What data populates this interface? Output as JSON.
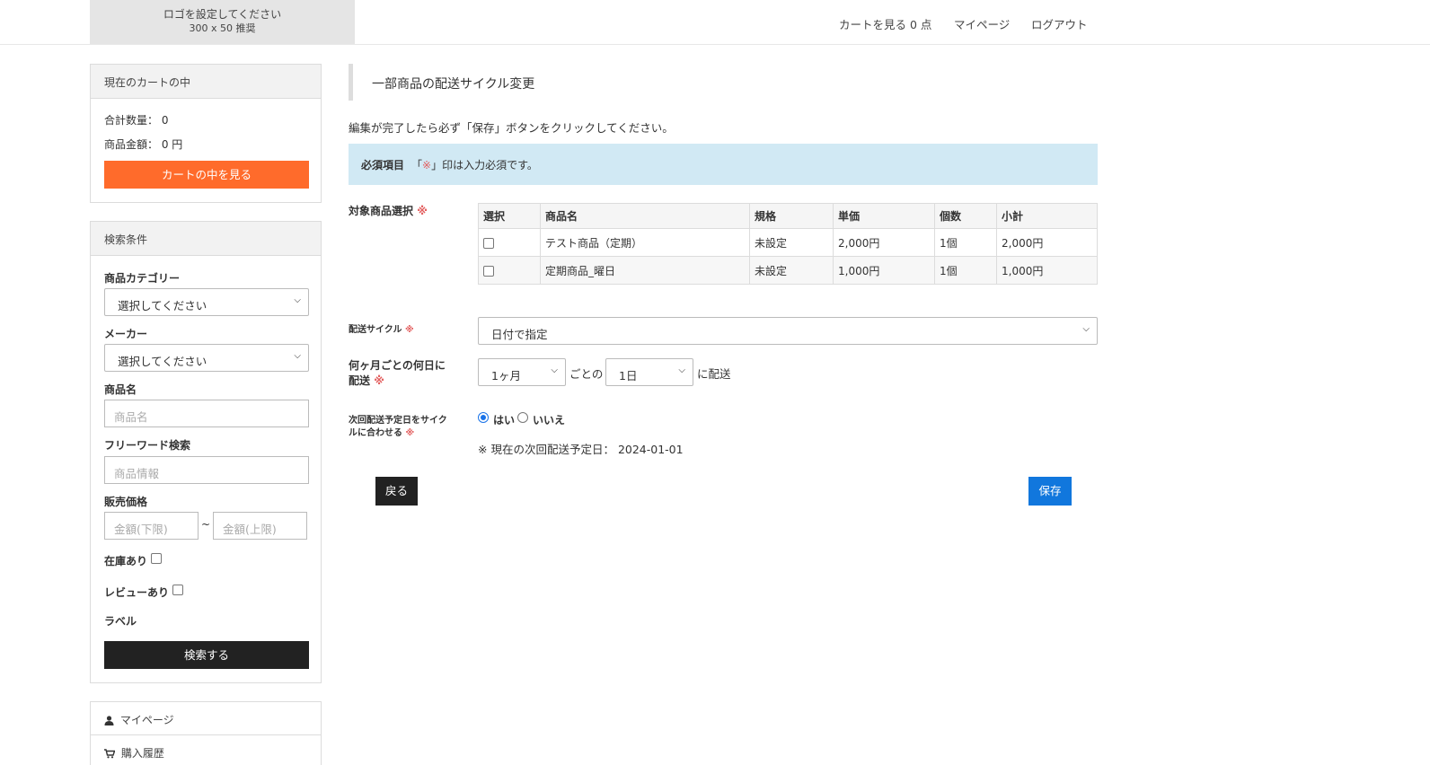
{
  "header": {
    "logo_line1": "ロゴを設定してください",
    "logo_line2": "300 x 50 推奨",
    "nav": {
      "cart": "カートを見る 0 点",
      "mypage": "マイページ",
      "logout": "ログアウト"
    }
  },
  "sidebar": {
    "cart": {
      "title": "現在のカートの中",
      "qty_label": "合計数量：",
      "qty_value": "0",
      "amount_label": "商品金額：",
      "amount_value": "0 円",
      "view_button": "カートの中を見る"
    },
    "search": {
      "title": "検索条件",
      "category_label": "商品カテゴリー",
      "category_value": "選択してください",
      "maker_label": "メーカー",
      "maker_value": "選択してください",
      "name_label": "商品名",
      "name_placeholder": "商品名",
      "freeword_label": "フリーワード検索",
      "freeword_placeholder": "商品情報",
      "price_label": "販売価格",
      "price_min_placeholder": "金額(下限)",
      "price_sep": "~",
      "price_max_placeholder": "金額(上限)",
      "in_stock_label": "在庫あり",
      "in_stock_checked": false,
      "review_label": "レビューあり",
      "review_checked": false,
      "tag_label": "ラベル",
      "search_button": "検索する"
    },
    "menu": {
      "mypage": "マイページ",
      "history": "購入履歴"
    }
  },
  "main": {
    "title": "一部商品の配送サイクル変更",
    "instruction": "編集が完了したら必ず「保存」ボタンをクリックしてください。",
    "required": {
      "label": "必須項目",
      "prefix": "「",
      "mark": "※",
      "suffix": "」印は入力必須です。"
    },
    "req_mark": "※",
    "product_select_label": "対象商品選択",
    "table": {
      "headers": [
        "選択",
        "商品名",
        "規格",
        "単価",
        "個数",
        "小計"
      ],
      "rows": [
        {
          "selected": false,
          "name": "テスト商品（定期）",
          "spec": "未設定",
          "price": "2,000円",
          "qty": "1個",
          "subtotal": "2,000円"
        },
        {
          "selected": false,
          "name": "定期商品_曜日",
          "spec": "未設定",
          "price": "1,000円",
          "qty": "1個",
          "subtotal": "1,000円"
        }
      ]
    },
    "cycle_label": "配送サイクル",
    "cycle_value": "日付で指定",
    "monthday_label_1": "何ヶ月ごとの何日に",
    "monthday_label_2": "配送",
    "month_value": "1ヶ月",
    "month_sep": "ごとの",
    "day_value": "1日",
    "day_suffix": "に配送",
    "match_label_1": "次回配送予定日をサイク",
    "match_label_2": "ルに合わせる",
    "match_yes": "はい",
    "match_no": "いいえ",
    "match_selected": "yes",
    "next_date_label": "※ 現在の次回配送予定日：",
    "next_date_value": "2024-01-01",
    "back_button": "戻る",
    "save_button": "保存"
  },
  "colors": {
    "accent_orange": "#ff6b2b",
    "save_blue": "#1177dd",
    "required_red": "#e36060",
    "info_bg": "#d1e9f4"
  }
}
